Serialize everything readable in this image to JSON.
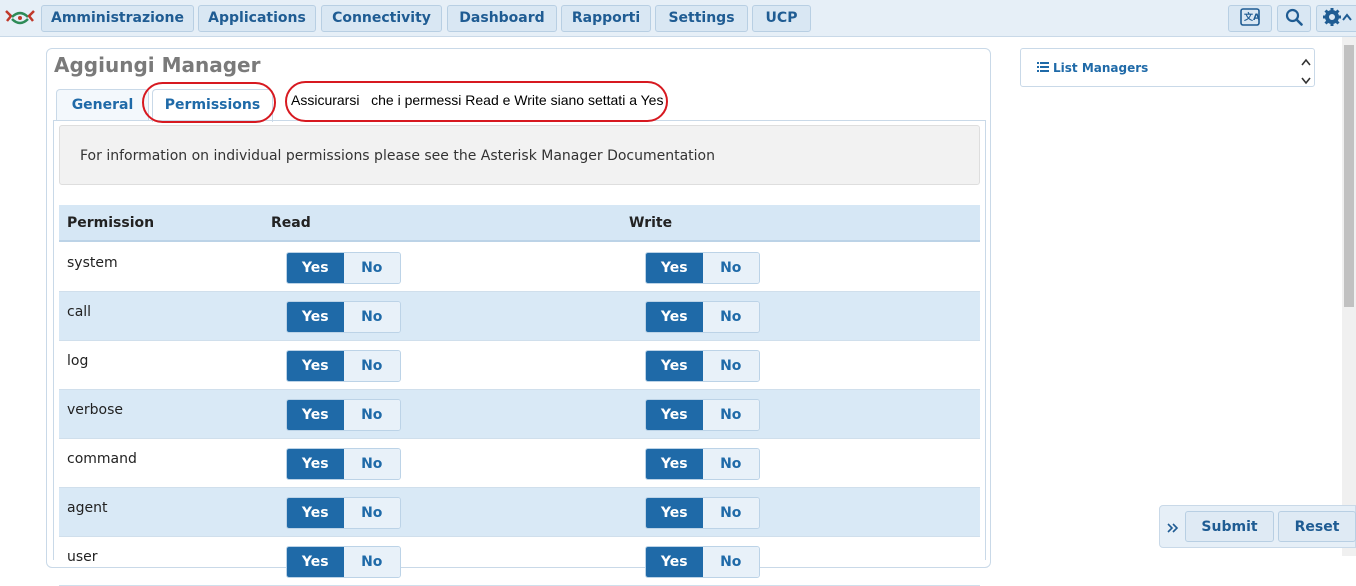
{
  "nav": {
    "items": [
      {
        "label": "Amministrazione"
      },
      {
        "label": "Applications"
      },
      {
        "label": "Connectivity"
      },
      {
        "label": "Dashboard"
      },
      {
        "label": "Rapporti"
      },
      {
        "label": "Settings"
      },
      {
        "label": "UCP"
      }
    ],
    "icons": [
      "language-icon",
      "search-icon",
      "gear-icon"
    ]
  },
  "page": {
    "title": "Aggiungi Manager"
  },
  "tabs": [
    {
      "label": "General"
    },
    {
      "label": "Permissions",
      "active": true
    }
  ],
  "annotation": {
    "text": "Assicurarsi   che i permessi Read e Write siano settati a Yes"
  },
  "info": {
    "text": "For information on individual permissions please see the Asterisk Manager Documentation"
  },
  "permissions": {
    "headers": {
      "permission": "Permission",
      "read": "Read",
      "write": "Write"
    },
    "yes_label": "Yes",
    "no_label": "No",
    "rows": [
      {
        "name": "system",
        "read": "Yes",
        "write": "Yes"
      },
      {
        "name": "call",
        "read": "Yes",
        "write": "Yes"
      },
      {
        "name": "log",
        "read": "Yes",
        "write": "Yes"
      },
      {
        "name": "verbose",
        "read": "Yes",
        "write": "Yes"
      },
      {
        "name": "command",
        "read": "Yes",
        "write": "Yes"
      },
      {
        "name": "agent",
        "read": "Yes",
        "write": "Yes"
      },
      {
        "name": "user",
        "read": "Yes",
        "write": "Yes"
      }
    ]
  },
  "sidebar": {
    "list_label": "List Managers"
  },
  "actions": {
    "submit": "Submit",
    "reset": "Reset"
  },
  "colors": {
    "accent": "#1f6aa8",
    "highlight": "#d71920",
    "nav_bg": "#e6eff7"
  }
}
